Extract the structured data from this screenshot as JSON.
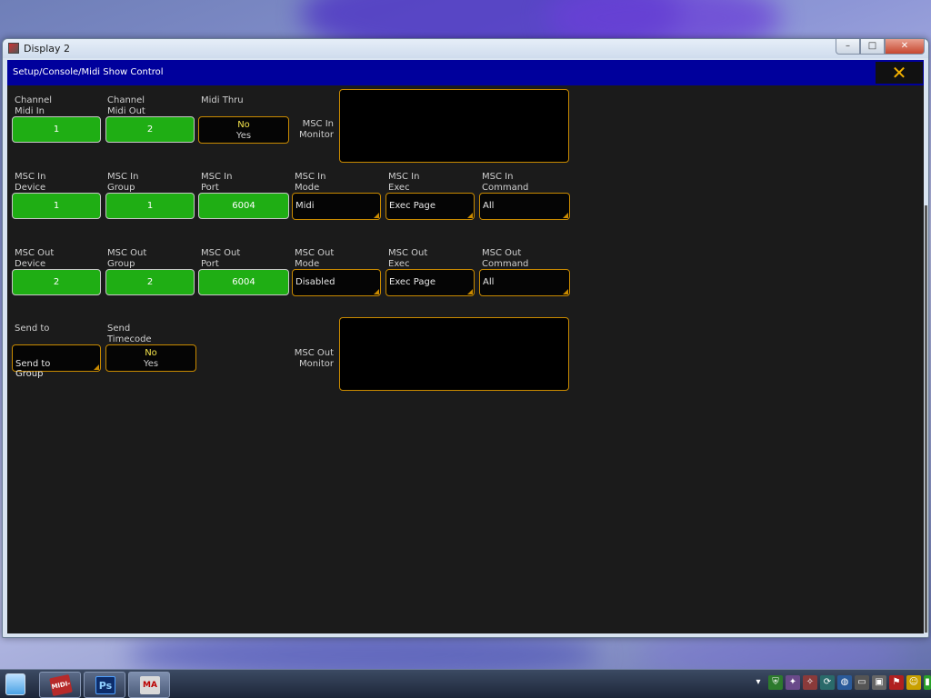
{
  "window": {
    "title": "Display 2",
    "controls": {
      "minimize": "–",
      "maximize": "□",
      "close": "✕"
    }
  },
  "header": {
    "path": "Setup/Console/Midi Show Control",
    "close_glyph": "✕",
    "colors": {
      "bar": "#00009c",
      "close_accent": "#f2b000"
    }
  },
  "row1": {
    "channel_midi_in": {
      "label": "Channel\nMidi In",
      "value": "1"
    },
    "channel_midi_out": {
      "label": "Channel\nMidi Out",
      "value": "2"
    },
    "midi_thru": {
      "label": "Midi Thru",
      "selected": "No",
      "alternate": "Yes"
    },
    "msc_in_monitor": {
      "label": "MSC In\nMonitor"
    }
  },
  "row2": {
    "msc_in_device": {
      "label": "MSC In\nDevice",
      "value": "1"
    },
    "msc_in_group": {
      "label": "MSC In\nGroup",
      "value": "1"
    },
    "msc_in_port": {
      "label": "MSC In\nPort",
      "value": "6004"
    },
    "msc_in_mode": {
      "label": "MSC In\nMode",
      "value": "Midi"
    },
    "msc_in_exec": {
      "label": "MSC In\nExec",
      "value": "Exec Page"
    },
    "msc_in_command": {
      "label": "MSC In\nCommand",
      "value": "All"
    }
  },
  "row3": {
    "msc_out_device": {
      "label": "MSC Out\nDevice",
      "value": "2"
    },
    "msc_out_group": {
      "label": "MSC Out\nGroup",
      "value": "2"
    },
    "msc_out_port": {
      "label": "MSC Out\nPort",
      "value": "6004"
    },
    "msc_out_mode": {
      "label": "MSC Out\nMode",
      "value": "Disabled"
    },
    "msc_out_exec": {
      "label": "MSC Out\nExec",
      "value": "Exec Page"
    },
    "msc_out_command": {
      "label": "MSC Out\nCommand",
      "value": "All"
    }
  },
  "row4": {
    "send_to": {
      "label": "Send to",
      "value": "Send to\nGroup"
    },
    "send_timecode": {
      "label": "Send\nTimecode",
      "selected": "No",
      "alternate": "Yes"
    },
    "msc_out_monitor": {
      "label": "MSC Out\nMonitor"
    }
  },
  "taskbar": {
    "items": [
      {
        "icon": "midi-ox-icon",
        "glyph": "MIDI-OX"
      },
      {
        "icon": "photoshop-icon",
        "glyph": "Ps"
      },
      {
        "icon": "grandma-onpc-icon",
        "glyph": "MA"
      }
    ],
    "tray": [
      {
        "icon": "tray-arrow-icon",
        "glyph": "▾"
      },
      {
        "icon": "tray-security-icon",
        "glyph": "⛨"
      },
      {
        "icon": "tray-network-icon",
        "glyph": "✦"
      },
      {
        "icon": "tray-tool-icon",
        "glyph": "✧"
      },
      {
        "icon": "tray-sync-icon",
        "glyph": "⟳"
      },
      {
        "icon": "tray-globe-icon",
        "glyph": "◍"
      },
      {
        "icon": "tray-monitor-icon",
        "glyph": "▭"
      },
      {
        "icon": "tray-chat-icon",
        "glyph": "▣"
      },
      {
        "icon": "tray-flag-icon",
        "glyph": "⚑"
      },
      {
        "icon": "tray-users-icon",
        "glyph": "☺"
      },
      {
        "icon": "tray-battery-icon",
        "glyph": "▮"
      }
    ]
  },
  "colors": {
    "value_button": "#1fae14",
    "select_border": "#c98a00",
    "toggle_selected_text": "#f2e14a",
    "background": "#1b1b1b"
  }
}
